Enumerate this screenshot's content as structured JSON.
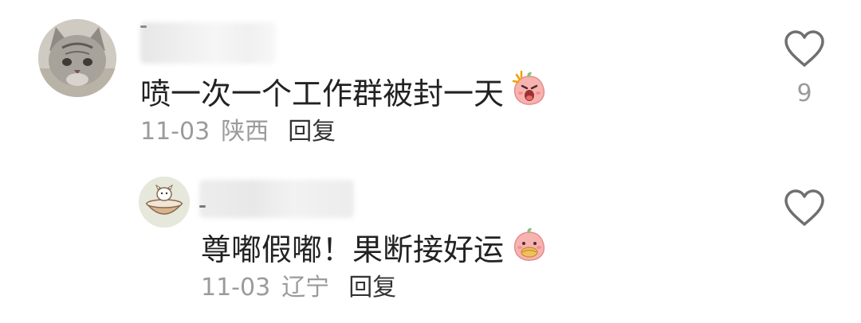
{
  "comment": {
    "text": "喷一次一个工作群被封一天",
    "date": "11-03",
    "location": "陕西",
    "reply_label": "回复",
    "like_count": "9",
    "sticker_icon": "shouting-peach-sticker"
  },
  "reply": {
    "text": "尊嘟假嘟！果断接好运",
    "date": "11-03",
    "location": "辽宁",
    "reply_label": "回复",
    "sticker_icon": "eating-peach-sticker"
  },
  "colors": {
    "text": "#222222",
    "meta": "#9b9b9b",
    "reply": "#333333",
    "icon": "#6f6f6f",
    "sticker": "#f6a9a9"
  }
}
